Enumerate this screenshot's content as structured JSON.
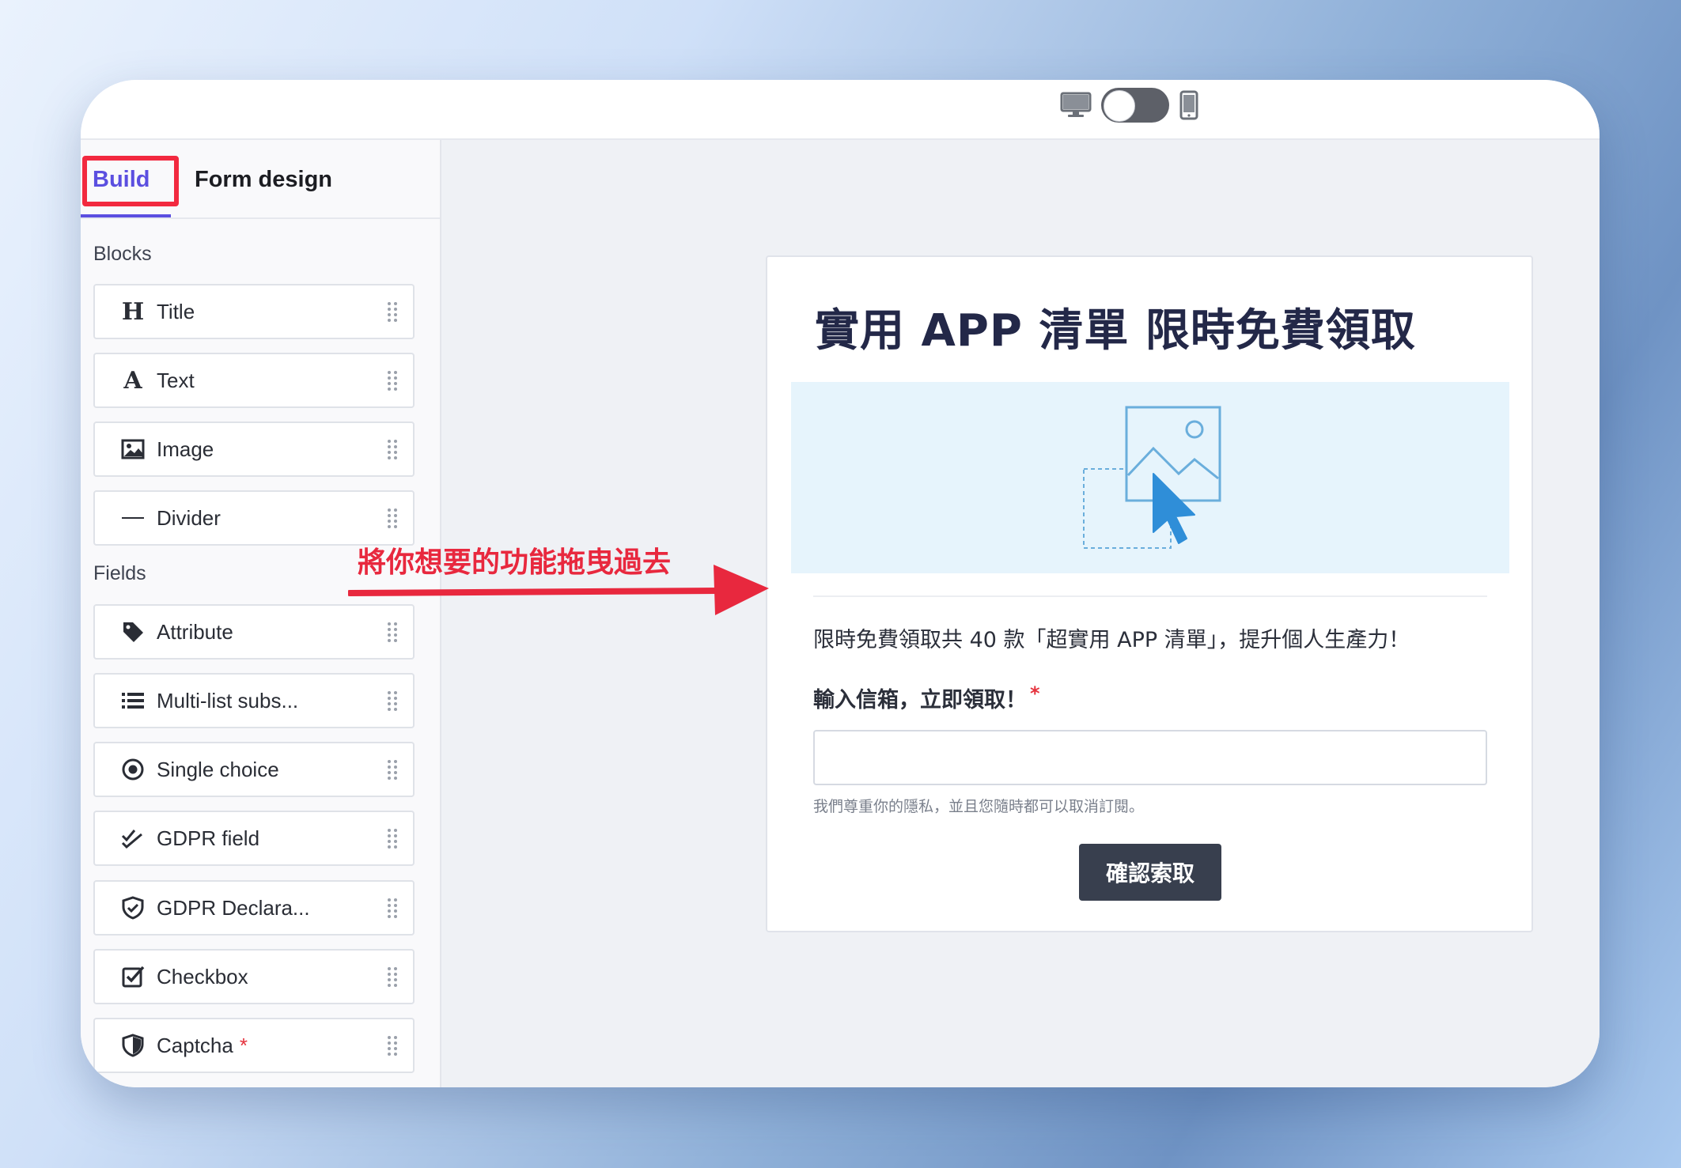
{
  "tabs": {
    "build": "Build",
    "form_design": "Form design"
  },
  "sidebar": {
    "blocks_label": "Blocks",
    "blocks": [
      {
        "label": "Title",
        "icon": "heading-icon"
      },
      {
        "label": "Text",
        "icon": "text-icon"
      },
      {
        "label": "Image",
        "icon": "image-icon"
      },
      {
        "label": "Divider",
        "icon": "divider-icon"
      }
    ],
    "fields_label": "Fields",
    "fields": [
      {
        "label": "Attribute",
        "icon": "tag-icon"
      },
      {
        "label": "Multi-list subs...",
        "icon": "list-icon"
      },
      {
        "label": "Single choice",
        "icon": "radio-icon"
      },
      {
        "label": "GDPR field",
        "icon": "double-check-icon"
      },
      {
        "label": "GDPR Declara...",
        "icon": "shield-check-icon"
      },
      {
        "label": "Checkbox",
        "icon": "checkbox-icon"
      },
      {
        "label": "Captcha",
        "icon": "shield-icon",
        "required": "*"
      }
    ]
  },
  "form": {
    "title": "實用 APP 清單 限時免費領取",
    "description": "限時免費領取共 40 款「超實用 APP 清單」，提升個人生產力！",
    "field_label": "輸入信箱，立即領取！",
    "field_required": "*",
    "email_value": "",
    "privacy_note": "我們尊重你的隱私，並且您隨時都可以取消訂閱。",
    "submit_label": "確認索取"
  },
  "annotation": {
    "text": "將你想要的功能拖曳過去",
    "color": "#e8283e"
  },
  "colors": {
    "accent": "#5b4fe0",
    "highlight": "#f2293f",
    "button": "#383f4e"
  }
}
